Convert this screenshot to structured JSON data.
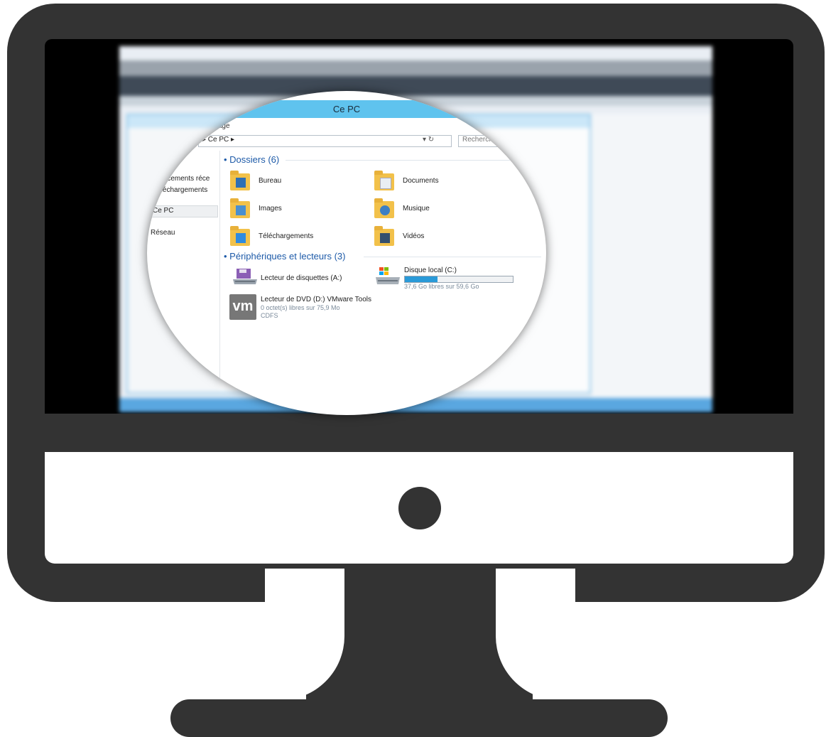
{
  "explorer": {
    "title": "Ce PC",
    "menu": "Affichage",
    "address": "▸ Ce PC ▸",
    "address_tools": "▾ ↻",
    "search_placeholder": "Rechercher",
    "nav": {
      "recent": "Emplacements réce",
      "downloads": "Téléchargements",
      "this_pc": "Ce PC",
      "network": "Réseau"
    },
    "folders_header": "Dossiers (6)",
    "folders": [
      {
        "label": "Bureau",
        "icon": "desktop-folder-icon"
      },
      {
        "label": "Documents",
        "icon": "documents-folder-icon"
      },
      {
        "label": "Images",
        "icon": "pictures-folder-icon"
      },
      {
        "label": "Musique",
        "icon": "music-folder-icon"
      },
      {
        "label": "Téléchargements",
        "icon": "downloads-folder-icon"
      },
      {
        "label": "Vidéos",
        "icon": "videos-folder-icon"
      }
    ],
    "devices_header": "Périphériques et lecteurs (3)",
    "devices": {
      "floppy": {
        "label": "Lecteur de disquettes (A:)",
        "icon": "floppy-drive-icon"
      },
      "local_disk": {
        "label": "Disque local (C:)",
        "sub": "37,6 Go libres sur 59,6 Go",
        "fill_fraction": 0.3,
        "icon": "hard-drive-icon"
      },
      "dvd": {
        "label": "Lecteur de DVD (D:) VMware Tools",
        "sub": "0 octet(s) libres sur 75,9 Mo",
        "fs": "CDFS",
        "icon": "vm-logo-icon",
        "icon_text": "vm"
      }
    }
  },
  "colors": {
    "frame": "#333333",
    "title_bar": "#5fc3ee",
    "section_text": "#1d5aa8",
    "disk_fill": "#2a9ad8"
  }
}
